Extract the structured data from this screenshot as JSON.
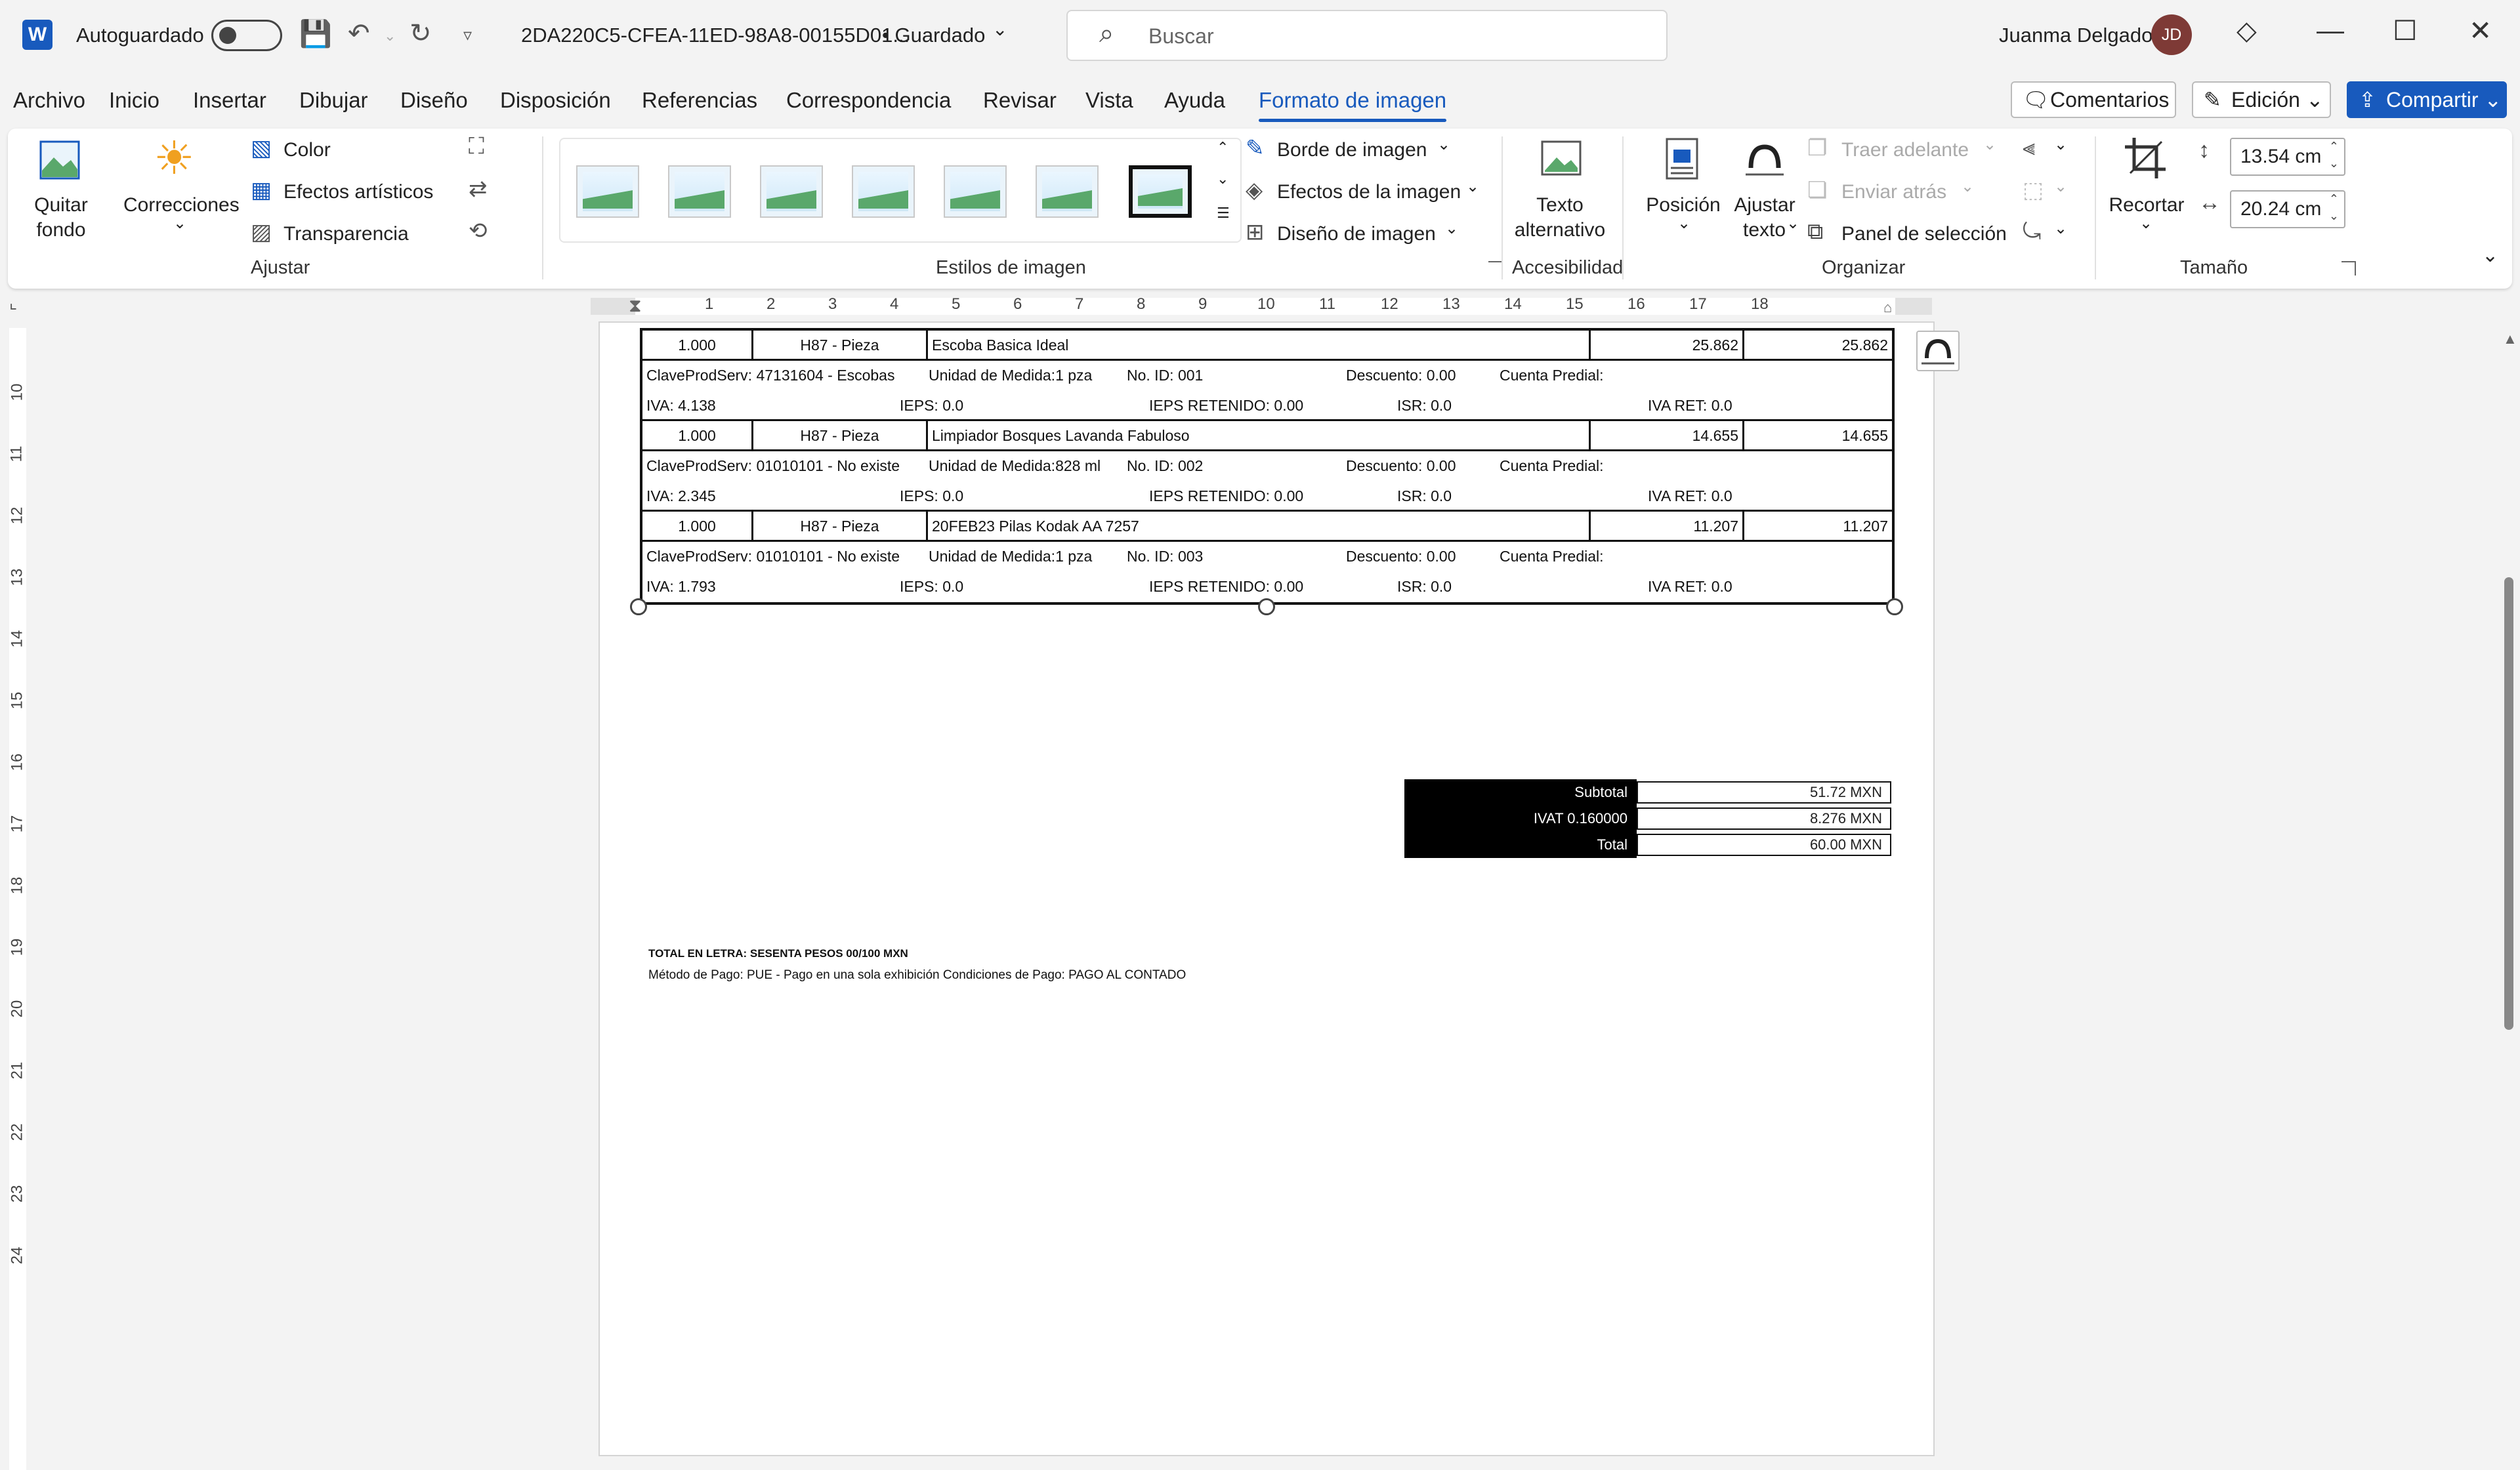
{
  "titlebar": {
    "autosave_label": "Autoguardado",
    "doc_name": "2DA220C5-CFEA-11ED-98A8-00155D01...",
    "saved_status": "• Guardado",
    "search_placeholder": "Buscar",
    "user_name": "Juanma Delgado",
    "user_initials": "JD",
    "word_logo": "W"
  },
  "menu": {
    "tabs": [
      "Archivo",
      "Inicio",
      "Insertar",
      "Dibujar",
      "Diseño",
      "Disposición",
      "Referencias",
      "Correspondencia",
      "Revisar",
      "Vista",
      "Ayuda",
      "Formato de imagen"
    ],
    "active_tab": "Formato de imagen",
    "comments_label": "Comentarios",
    "editing_label": "Edición",
    "share_label": "Compartir"
  },
  "ribbon": {
    "ajustar": {
      "label": "Ajustar",
      "remove_bg": [
        "Quitar",
        "fondo"
      ],
      "corrections": "Correcciones",
      "color": "Color",
      "artistic": "Efectos artísticos",
      "transparency": "Transparencia"
    },
    "estilos": {
      "label": "Estilos de imagen",
      "border": "Borde de imagen",
      "effects": "Efectos de la imagen",
      "layout": "Diseño de imagen"
    },
    "accesibilidad": {
      "label": "Accesibilidad",
      "alt_text": [
        "Texto",
        "alternativo"
      ]
    },
    "organizar": {
      "label": "Organizar",
      "position": "Posición",
      "wrap": [
        "Ajustar",
        "texto"
      ],
      "bring_forward": "Traer adelante",
      "send_backward": "Enviar atrás",
      "selection_pane": "Panel de selección"
    },
    "tamano": {
      "label": "Tamaño",
      "crop": "Recortar",
      "height": "13.54 cm",
      "width": "20.24 cm"
    }
  },
  "ruler": {
    "h_numbers": [
      "1",
      "2",
      "3",
      "4",
      "5",
      "6",
      "7",
      "8",
      "9",
      "10",
      "11",
      "12",
      "13",
      "14",
      "15",
      "16",
      "17",
      "18"
    ],
    "v_numbers": [
      "10",
      "11",
      "12",
      "13",
      "14",
      "15",
      "16",
      "17",
      "18",
      "19",
      "20",
      "21",
      "22",
      "23",
      "24"
    ]
  },
  "invoice": {
    "items": [
      {
        "qty": "1.000",
        "unit": "H87 - Pieza",
        "desc": "Escoba Basica Ideal",
        "price": "25.862",
        "amount": "25.862",
        "clave": "ClaveProdServ: 47131604 - Escobas",
        "medida": "Unidad de Medida:1 pza",
        "id": "No. ID: 001",
        "descuento": "Descuento: 0.00",
        "predial": "Cuenta Predial:",
        "iva": "IVA: 4.138",
        "ieps": "IEPS: 0.0",
        "ieps_ret": "IEPS RETENIDO: 0.00",
        "isr": "ISR: 0.0",
        "iva_ret": "IVA RET: 0.0"
      },
      {
        "qty": "1.000",
        "unit": "H87 - Pieza",
        "desc": "Limpiador Bosques Lavanda Fabuloso",
        "price": "14.655",
        "amount": "14.655",
        "clave": "ClaveProdServ: 01010101 - No existe",
        "medida": "Unidad de Medida:828 ml",
        "id": "No. ID: 002",
        "descuento": "Descuento: 0.00",
        "predial": "Cuenta Predial:",
        "iva": "IVA: 2.345",
        "ieps": "IEPS: 0.0",
        "ieps_ret": "IEPS RETENIDO: 0.00",
        "isr": "ISR: 0.0",
        "iva_ret": "IVA RET: 0.0"
      },
      {
        "qty": "1.000",
        "unit": "H87 - Pieza",
        "desc": "20FEB23 Pilas Kodak AA 7257",
        "price": "11.207",
        "amount": "11.207",
        "clave": "ClaveProdServ: 01010101 - No existe",
        "medida": "Unidad de Medida:1 pza",
        "id": "No. ID: 003",
        "descuento": "Descuento: 0.00",
        "predial": "Cuenta Predial:",
        "iva": "IVA: 1.793",
        "ieps": "IEPS: 0.0",
        "ieps_ret": "IEPS RETENIDO: 0.00",
        "isr": "ISR: 0.0",
        "iva_ret": "IVA RET: 0.0"
      }
    ],
    "totals": [
      {
        "label": "Subtotal",
        "value": "51.72 MXN"
      },
      {
        "label": "IVAT 0.160000",
        "value": "8.276 MXN"
      },
      {
        "label": "Total",
        "value": "60.00 MXN"
      }
    ],
    "total_letra": "TOTAL EN LETRA: SESENTA PESOS 00/100 MXN",
    "metodo_pago": "Método de Pago: PUE - Pago en una sola exhibición Condiciones de Pago: PAGO AL CONTADO"
  },
  "colors": {
    "accent": "#185abd",
    "avatar": "#7e3a36"
  }
}
